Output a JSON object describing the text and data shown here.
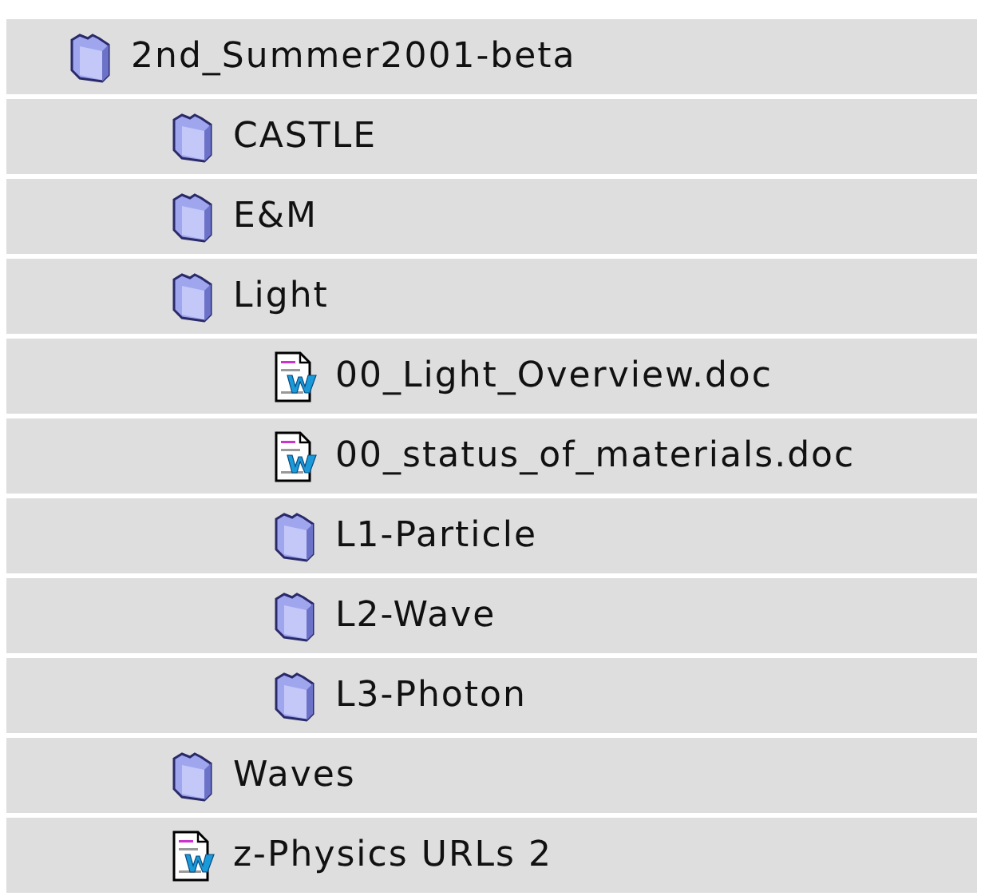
{
  "items": [
    {
      "kind": "folder",
      "name": "2nd_Summer2001-beta",
      "children": [
        {
          "kind": "folder",
          "name": "CASTLE"
        },
        {
          "kind": "folder",
          "name": "E&M"
        },
        {
          "kind": "folder",
          "name": "Light",
          "children": [
            {
              "kind": "document",
              "name": "00_Light_Overview.doc"
            },
            {
              "kind": "document",
              "name": "00_status_of_materials.doc"
            },
            {
              "kind": "folder",
              "name": "L1-Particle"
            },
            {
              "kind": "folder",
              "name": "L2-Wave"
            },
            {
              "kind": "folder",
              "name": "L3-Photon"
            }
          ]
        },
        {
          "kind": "folder",
          "name": "Waves"
        },
        {
          "kind": "document",
          "name": "z-Physics URLs 2"
        }
      ]
    }
  ]
}
